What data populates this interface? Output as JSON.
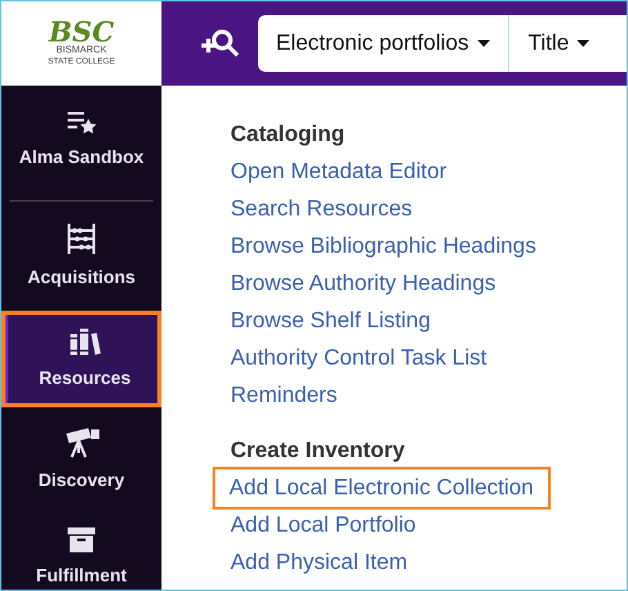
{
  "logo": {
    "mark": "BSC",
    "name": "BISMARCK",
    "tagline": "STATE COLLEGE"
  },
  "search": {
    "scope": "Electronic portfolios",
    "field": "Title"
  },
  "sidebar": {
    "items": [
      {
        "kind": "list-star",
        "label": "Alma Sandbox",
        "selected": false,
        "highlighted": false
      },
      {
        "kind": "abacus",
        "label": "Acquisitions",
        "selected": false,
        "highlighted": false
      },
      {
        "kind": "books",
        "label": "Resources",
        "selected": true,
        "highlighted": true
      },
      {
        "kind": "telescope",
        "label": "Discovery",
        "selected": false,
        "highlighted": false
      },
      {
        "kind": "box",
        "label": "Fulfillment",
        "selected": false,
        "highlighted": false
      }
    ]
  },
  "menu": {
    "sections": [
      {
        "heading": "Cataloging",
        "items": [
          {
            "label": "Open Metadata Editor",
            "highlighted": false
          },
          {
            "label": "Search Resources",
            "highlighted": false
          },
          {
            "label": "Browse Bibliographic Headings",
            "highlighted": false
          },
          {
            "label": "Browse Authority Headings",
            "highlighted": false
          },
          {
            "label": "Browse Shelf Listing",
            "highlighted": false
          },
          {
            "label": "Authority Control Task List",
            "highlighted": false
          },
          {
            "label": "Reminders",
            "highlighted": false
          }
        ]
      },
      {
        "heading": "Create Inventory",
        "items": [
          {
            "label": "Add Local Electronic Collection",
            "highlighted": true
          },
          {
            "label": "Add Local Portfolio",
            "highlighted": false
          },
          {
            "label": "Add Physical Item",
            "highlighted": false
          }
        ]
      }
    ]
  }
}
